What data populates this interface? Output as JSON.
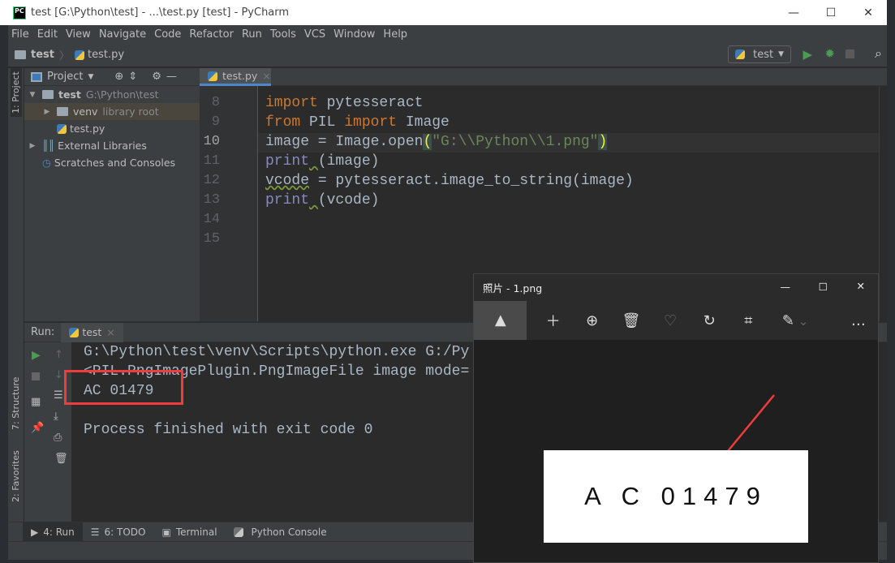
{
  "window": {
    "title": "test [G:\\Python\\test] - ...\\test.py [test] - PyCharm",
    "logo": "PC"
  },
  "menu": [
    "File",
    "Edit",
    "View",
    "Navigate",
    "Code",
    "Refactor",
    "Run",
    "Tools",
    "VCS",
    "Window",
    "Help"
  ],
  "breadcrumb": {
    "project": "test",
    "file": "test.py"
  },
  "run_config": "test",
  "project_panel": {
    "title": "Project",
    "tree": [
      {
        "name": "test",
        "hint": "G:\\Python\\test"
      },
      {
        "name": "venv",
        "hint": "library root"
      },
      {
        "name": "test.py",
        "hint": ""
      },
      {
        "name": "External Libraries",
        "hint": ""
      },
      {
        "name": "Scratches and Consoles",
        "hint": ""
      }
    ]
  },
  "side_tabs": {
    "project": "1: Project",
    "structure": "7: Structure",
    "favorites": "2: Favorites"
  },
  "editor": {
    "tab": "test.py",
    "lines": [
      {
        "n": "8",
        "tokens": [
          {
            "t": "import",
            "c": "kw"
          },
          {
            "t": " pytesseract",
            "c": ""
          }
        ]
      },
      {
        "n": "9",
        "tokens": [
          {
            "t": "from",
            "c": "kw"
          },
          {
            "t": " PIL ",
            "c": ""
          },
          {
            "t": "import",
            "c": "kw"
          },
          {
            "t": " Image",
            "c": ""
          }
        ]
      },
      {
        "n": "10",
        "tokens": [
          {
            "t": "image = Image.open",
            "c": ""
          },
          {
            "t": "(",
            "c": "br"
          },
          {
            "t": "\"G:\\\\Python\\\\1.png\"",
            "c": "str"
          },
          {
            "t": ")",
            "c": "br"
          }
        ]
      },
      {
        "n": "11",
        "tokens": [
          {
            "t": "print",
            "c": "bi"
          },
          {
            "t": " ",
            "c": "wv"
          },
          {
            "t": "(image)",
            "c": ""
          }
        ]
      },
      {
        "n": "12",
        "tokens": [
          {
            "t": "vcode",
            "c": "wv"
          },
          {
            "t": " = pytesseract.image_to_string(image)",
            "c": ""
          }
        ]
      },
      {
        "n": "13",
        "tokens": [
          {
            "t": "print",
            "c": "bi"
          },
          {
            "t": " ",
            "c": "wv"
          },
          {
            "t": "(vcode)",
            "c": ""
          }
        ]
      },
      {
        "n": "14",
        "tokens": []
      },
      {
        "n": "15",
        "tokens": []
      }
    ]
  },
  "run": {
    "label": "Run:",
    "tab": "test",
    "output": [
      "G:\\Python\\test\\venv\\Scripts\\python.exe G:/Py",
      "<PIL.PngImagePlugin.PngImageFile image mode=",
      "AC 01479",
      "",
      "Process finished with exit code 0"
    ]
  },
  "bottom_tabs": [
    "4: Run",
    "6: TODO",
    "Terminal",
    "Python Console"
  ],
  "photos": {
    "title": "照片 - 1.png",
    "image_text": "A C 01479",
    "toolbar": [
      "image-icon",
      "add-icon",
      "zoom-in-icon",
      "delete-icon",
      "heart-icon",
      "rotate-icon",
      "crop-icon",
      "edit-icon",
      "more-icon"
    ]
  },
  "colors": {
    "highlight_box": "#f03c3c",
    "run_green": "#499c54",
    "accent": "#4a88c7"
  }
}
